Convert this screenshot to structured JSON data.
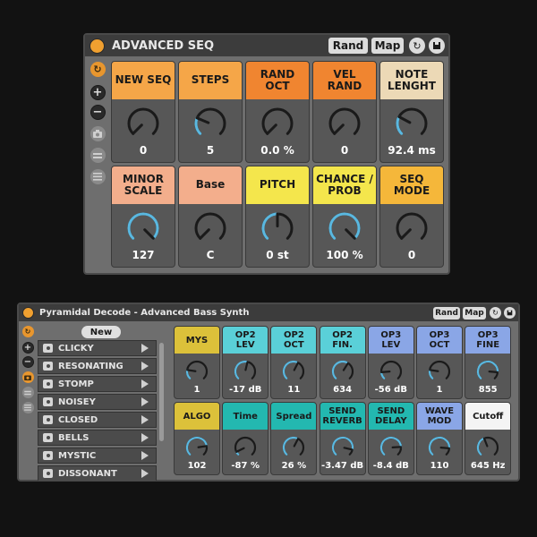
{
  "colors": {
    "orange": "#f5a648",
    "deep_orange": "#f08530",
    "beige": "#ecd9b6",
    "salmon": "#f3ae8c",
    "yellow": "#f4e64c",
    "gold": "#f5b73a",
    "mustard": "#dcc13a",
    "cyan": "#5ad0d8",
    "teal": "#23b8b0",
    "lavender": "#8aa6e6",
    "white": "#f4f4f4",
    "knob_arc": "#5ab8e0"
  },
  "device1": {
    "title": "ADVANCED SEQ",
    "rand_label": "Rand",
    "map_label": "Map",
    "icons": [
      "power-icon",
      "link-icon",
      "save-icon",
      "hot-swap-icon",
      "plus-icon",
      "minus-icon",
      "camera-icon",
      "list-icon"
    ],
    "cells": [
      {
        "label": "NEW SEQ",
        "value": "0",
        "color": "#f5a648",
        "level": 0.0
      },
      {
        "label": "STEPS",
        "value": "5",
        "color": "#f5a648",
        "level": 0.25
      },
      {
        "label": "RAND OCT",
        "value": "0.0 %",
        "color": "#f08530",
        "level": 0.0
      },
      {
        "label": "VEL RAND",
        "value": "0",
        "color": "#f08530",
        "level": 0.0
      },
      {
        "label": "NOTE LENGHT",
        "value": "92.4 ms",
        "color": "#ecd9b6",
        "level": 0.27
      },
      {
        "label": "MINOR SCALE",
        "value": "127",
        "color": "#f3ae8c",
        "level": 1.0
      },
      {
        "label": "Base",
        "value": "C",
        "color": "#f3ae8c",
        "level": 0.0
      },
      {
        "label": "PITCH",
        "value": "0 st",
        "color": "#f4e64c",
        "level": 0.5
      },
      {
        "label": "CHANCE / PROB",
        "value": "100 %",
        "color": "#f4e64c",
        "level": 1.0
      },
      {
        "label": "SEQ MODE",
        "value": "0",
        "color": "#f5b73a",
        "level": 0.0
      }
    ]
  },
  "device2": {
    "title": "Pyramidal Decode - Advanced Bass Synth",
    "rand_label": "Rand",
    "map_label": "Map",
    "new_label": "New",
    "presets": [
      "CLICKY",
      "RESONATING",
      "STOMP",
      "NOISEY",
      "CLOSED",
      "BELLS",
      "MYSTIC",
      "DISSONANT"
    ],
    "cells": [
      {
        "label": "MYS",
        "value": "1",
        "color": "#dcc13a",
        "level": 0.2
      },
      {
        "label": "OP2 LEV",
        "value": "-17 dB",
        "color": "#5ad0d8",
        "level": 0.55
      },
      {
        "label": "OP2 OCT",
        "value": "11",
        "color": "#5ad0d8",
        "level": 0.6
      },
      {
        "label": "OP2 FIN.",
        "value": "634",
        "color": "#5ad0d8",
        "level": 0.62
      },
      {
        "label": "OP3 LEV",
        "value": "-56 dB",
        "color": "#8aa6e6",
        "level": 0.15
      },
      {
        "label": "OP3 OCT",
        "value": "1",
        "color": "#8aa6e6",
        "level": 0.2
      },
      {
        "label": "OP3 FINE",
        "value": "855",
        "color": "#8aa6e6",
        "level": 0.85
      },
      {
        "label": "ALGO",
        "value": "102",
        "color": "#dcc13a",
        "level": 0.8
      },
      {
        "label": "Time",
        "value": "-87 %",
        "color": "#23b8b0",
        "level": 0.07
      },
      {
        "label": "Spread",
        "value": "26 %",
        "color": "#23b8b0",
        "level": 0.6
      },
      {
        "label": "SEND REVERB",
        "value": "-3.47 dB",
        "color": "#23b8b0",
        "level": 0.88
      },
      {
        "label": "SEND DELAY",
        "value": "-8.4 dB",
        "color": "#23b8b0",
        "level": 0.82
      },
      {
        "label": "WAVE MOD",
        "value": "110",
        "color": "#8aa6e6",
        "level": 0.85
      },
      {
        "label": "Cutoff",
        "value": "645 Hz",
        "color": "#f4f4f4",
        "level": 0.42
      }
    ]
  }
}
